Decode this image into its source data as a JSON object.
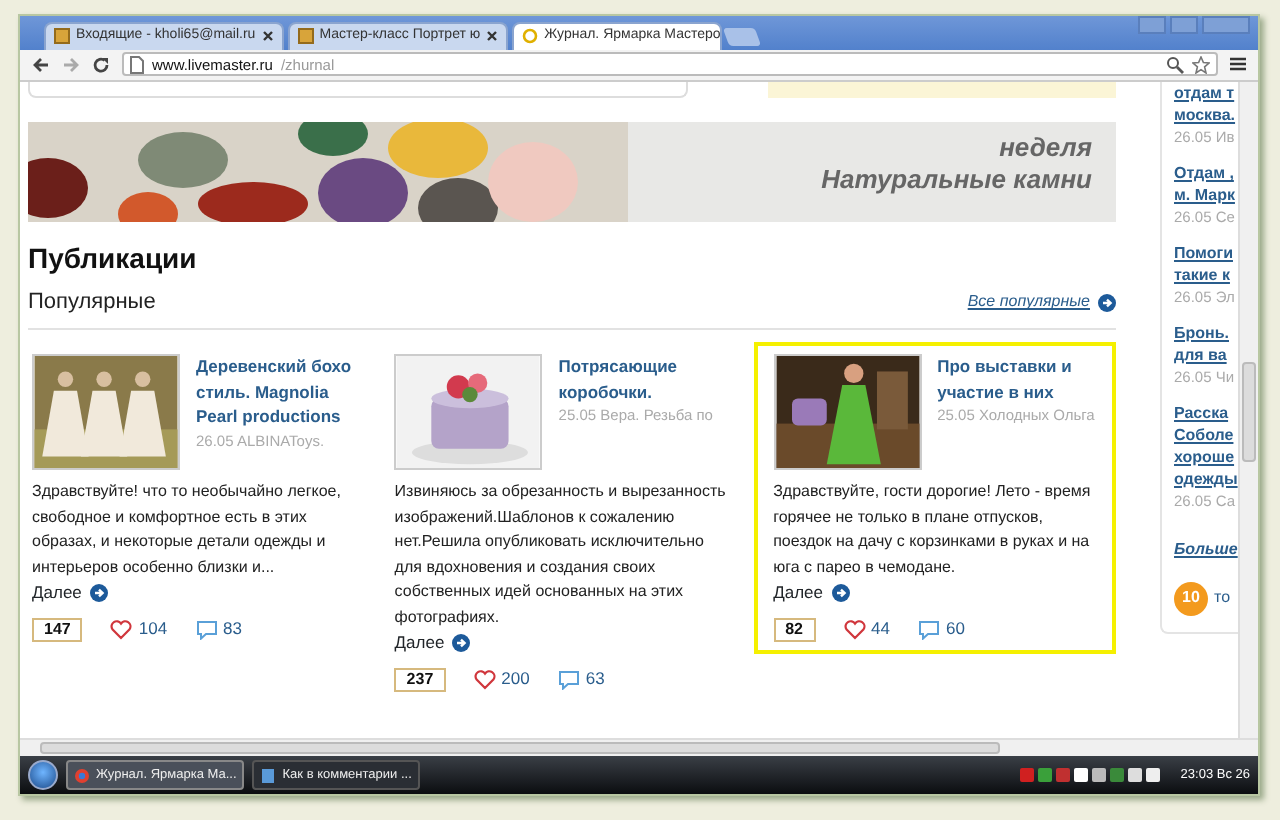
{
  "browser": {
    "tabs": [
      {
        "title": "Входящие - kholi65@mail.ru",
        "selected": false
      },
      {
        "title": "Мастер-класс Портрет ю",
        "selected": false
      },
      {
        "title": "Журнал. Ярмарка Мастеро",
        "selected": true
      }
    ],
    "url": {
      "host": "www.livemaster.ru",
      "path": "/zhurnal"
    }
  },
  "banner": {
    "lines": [
      "неделя",
      "Натуральные камни"
    ]
  },
  "section": {
    "title": "Публикации",
    "subtitle": "Популярные",
    "all_link": "Все популярные"
  },
  "posts": [
    {
      "title": "Деревенский бохо стиль. Magnolia Pearl productions",
      "meta": "26.05 ALBINAToys.",
      "excerpt": "Здравствуйте! что то необычайно легкое, свободное и комфортное есть в этих образах, и некоторые детали одежды и интерьеров особенно близки и...",
      "more": "Далее",
      "views": "147",
      "likes": "104",
      "comments": "83",
      "highlighted": false,
      "kind": "figures"
    },
    {
      "title": "Потрясающие коробочки.",
      "meta": "25.05 Вера. Резьба по",
      "excerpt": "Извиняюсь за обрезанность и вырезанность изображений.Шаблонов к сожалению нет.Решила опубликовать исключительно для вдохновения и создания своих собственных идей основанных на этих фотографиях.",
      "more": "Далее",
      "views": "237",
      "likes": "200",
      "comments": "63",
      "highlighted": false,
      "kind": "box"
    },
    {
      "title": "Про выставки и участие в них",
      "meta": "25.05 Холодных Ольга",
      "excerpt": "Здравствуйте, гости дорогие! Лето - время горячее не только в плане отпусков, поездок на дачу с корзинками в руках и на юга с парео в чемодане.",
      "more": "Далее",
      "views": "82",
      "likes": "44",
      "comments": "60",
      "highlighted": true,
      "kind": "figure"
    }
  ],
  "sidebar": {
    "items": [
      {
        "title_lines": [
          "отдам т",
          "москва."
        ],
        "meta": "26.05 Ив"
      },
      {
        "title_lines": [
          "Отдам ,",
          "м. Марк"
        ],
        "meta": "26.05 Се"
      },
      {
        "title_lines": [
          "Помоги",
          "такие к"
        ],
        "meta": "26.05 Эл"
      },
      {
        "title_lines": [
          "Бронь.",
          "для ва"
        ],
        "meta": "26.05 Чи"
      },
      {
        "title_lines": [
          "Расска",
          "Соболе",
          "хороше",
          "одежды"
        ],
        "meta": "26.05 Са"
      }
    ],
    "more": "Больше",
    "badge": "10",
    "badge_text": "то"
  },
  "taskbar": {
    "tasks": [
      {
        "label": "Журнал. Ярмарка Ма...",
        "selected": true
      },
      {
        "label": "Как в комментарии ...",
        "selected": false
      }
    ],
    "clock": "23:03 Вс 26"
  }
}
